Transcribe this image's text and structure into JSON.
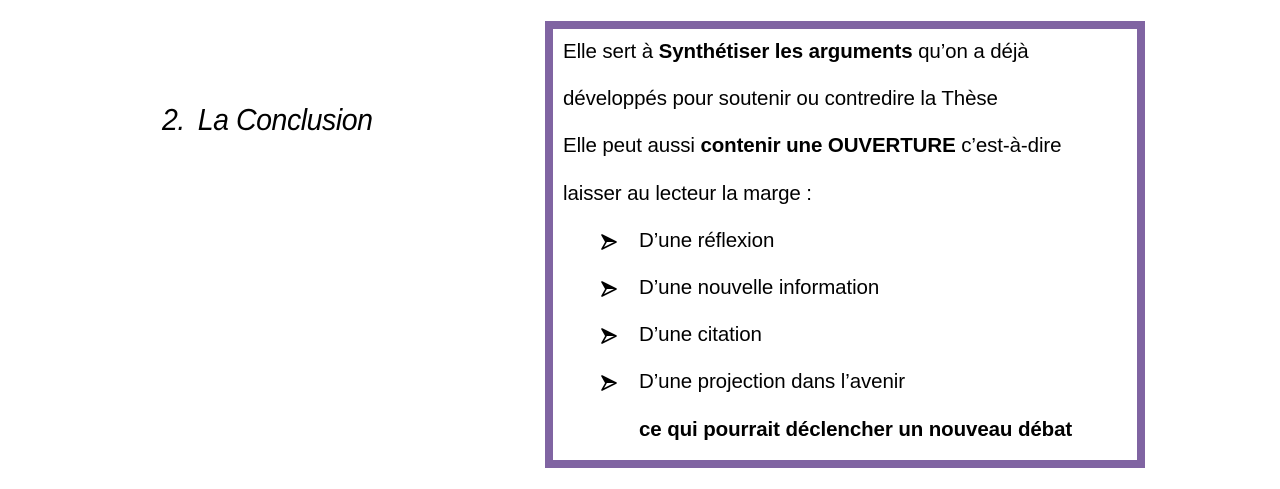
{
  "heading": {
    "number": "2.",
    "title": "La Conclusion"
  },
  "box": {
    "border_color": "#8064a2",
    "p1": {
      "pre": "Elle sert à ",
      "bold": "Synthétiser les arguments",
      "post": " qu’on a déjà"
    },
    "p1_cont": "développés pour soutenir ou contredire la Thèse",
    "p2": {
      "pre": "Elle peut aussi ",
      "bold": "contenir une OUVERTURE",
      "post": " c’est-à-dire"
    },
    "p2_cont": "laisser au lecteur la marge :",
    "bullet_icon": "arrowhead-bullet-icon",
    "bullets": [
      "D’une réflexion",
      "D’une nouvelle information",
      "D’une citation",
      "D’une projection dans l’avenir"
    ],
    "final": "ce qui pourrait déclencher un nouveau débat"
  }
}
